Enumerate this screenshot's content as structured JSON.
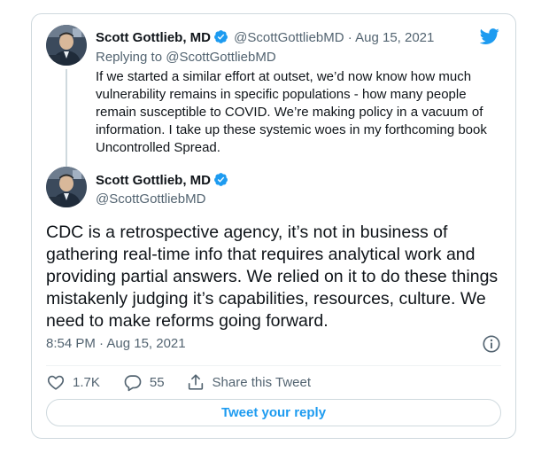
{
  "reply_tweet": {
    "name": "Scott Gottlieb, MD",
    "handle": "@ScottGottliebMD",
    "separator": "·",
    "date": "Aug 15, 2021",
    "replying_prefix": "Replying to",
    "replying_to": "@ScottGottliebMD",
    "text": "If we started a similar effort at outset, we’d now know how much vulnerability remains in specific populations - how many people remain susceptible to COVID. We’re making policy in a vacuum of information. I take up these systemic woes in my forthcoming book Uncontrolled Spread."
  },
  "main_tweet": {
    "name": "Scott Gottlieb, MD",
    "handle": "@ScottGottliebMD",
    "text": "CDC is a retrospective agency, it’s not in business of gathering real-time info that requires analytical work and providing partial answers. We relied on it to do these things mistakenly judging it’s capabilities, resources, culture. We need to make reforms going forward.",
    "timestamp": "8:54 PM · Aug 15, 2021"
  },
  "actions": {
    "likes": "1.7K",
    "replies": "55",
    "share_label": "Share this Tweet"
  },
  "reply_button_label": "Tweet your reply",
  "colors": {
    "accent": "#1d9bf0",
    "text": "#0f1419",
    "muted": "#536471",
    "border": "#cfd9de"
  },
  "icons": {
    "brand": "twitter-bird-icon",
    "verified": "verified-badge-icon",
    "info": "info-icon",
    "like": "heart-icon",
    "reply": "speech-bubble-icon",
    "share": "share-icon"
  }
}
